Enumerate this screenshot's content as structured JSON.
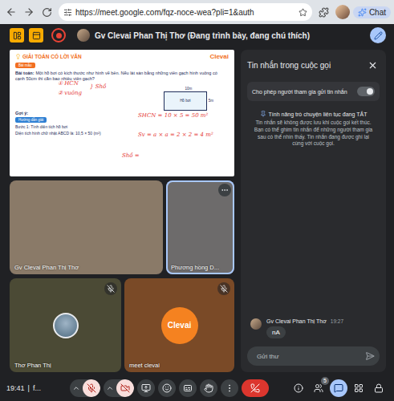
{
  "browser": {
    "url": "https://meet.google.com/fqz-noce-wea?pli=1&auth",
    "chat_button": "Chat"
  },
  "meeting": {
    "presenter_label": "Gv Clevai Phan Thị Thơ (Đang trình bày, đang chú thích)",
    "recording": true
  },
  "slide": {
    "title": "GIẢI TOÁN CÓ LỜI VĂN",
    "logo": "Clevai",
    "problem_tag": "Bài mẫu",
    "problem_label": "Bài toán:",
    "problem_text": "Một hồ bơi có kích thước như hình vẽ bên. Nếu lát sàn bằng những viên gạch hình vuông có cạnh 50cm thì cần bao nhiêu viên gạch?",
    "hint_label": "Gợi ý:",
    "hint_tag": "Hướng dẫn giải",
    "steps": [
      "Bước 1: Tính diện tích hồ bơi",
      "Diện tích hình chữ nhật ABCD là: 10,5 × 50 (m²)"
    ],
    "figure": {
      "label": "Hồ bơi",
      "width": "10m",
      "height": "5m"
    },
    "annotations": [
      "① HCN",
      "② vuông",
      "} Shồ",
      "SHCN = 10 × 5 = 50 m²",
      "Sv = a × a = 2 × 2 = 4 m²",
      "Shồ ="
    ]
  },
  "tiles": [
    {
      "name": "Gv Clevai Phan Thị Thơ",
      "kind": "video",
      "muted": false,
      "focused": false
    },
    {
      "name": "Phương hồng D...",
      "kind": "video",
      "muted": false,
      "focused": true
    },
    {
      "name": "Thơ Phan Thị",
      "kind": "avatar",
      "muted": true,
      "focused": false
    },
    {
      "name": "meet clevai",
      "kind": "logo",
      "muted": true,
      "focused": false,
      "logo": "Clevai"
    }
  ],
  "chat": {
    "title": "Tin nhắn trong cuộc gọi",
    "allow_messages": {
      "label": "Cho phép người tham gia gửi tin nhắn",
      "on": true
    },
    "info_title": "Tính năng trò chuyện liên tục đang TẮT",
    "info_text": "Tin nhắn sẽ không được lưu khi cuộc gọi kết thúc. Bạn có thể ghim tin nhắn để những người tham gia sau có thể nhìn thấy. Tin nhắn đang được ghi lại cùng với cuộc gọi.",
    "messages": [
      {
        "sender": "Gv Clevai Phan Thị Thơ",
        "time": "19:27",
        "text": "nA"
      }
    ],
    "input_placeholder": "Gửi thư"
  },
  "bottom_bar": {
    "time": "19:41",
    "separator": "|",
    "meeting_code": "f...",
    "mic_muted": true,
    "camera_off": true,
    "people_count": "5",
    "chat_active": true
  }
}
